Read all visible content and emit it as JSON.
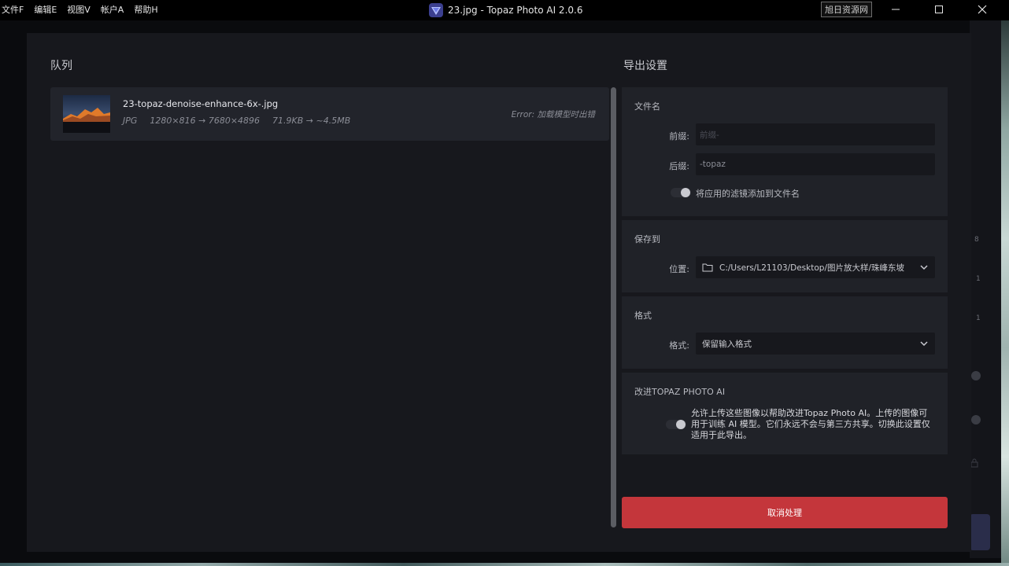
{
  "menu": [
    "文件F",
    "编辑E",
    "视图V",
    "帐户A",
    "帮助H"
  ],
  "window": {
    "title": "23.jpg - Topaz Photo AI 2.0.6"
  },
  "brand_badge": "旭日资源网",
  "background": {
    "numbers": [
      "8",
      "1",
      "1"
    ]
  },
  "queue": {
    "title": "队列",
    "items": [
      {
        "filename": "23-topaz-denoise-enhance-6x-.jpg",
        "format": "JPG",
        "resolution": "1280×816 → 7680×4896",
        "size": "71.9KB → ~4.5MB",
        "status": "Error: 加载模型时出错"
      }
    ]
  },
  "export": {
    "title": "导出设置",
    "filename": {
      "section_title": "文件名",
      "prefix_label": "前缀:",
      "prefix_placeholder": "前缀-",
      "suffix_label": "后缀:",
      "suffix_value": "-topaz",
      "filter_toggle_label": "将应用的滤镜添加到文件名",
      "filter_toggle_on": false
    },
    "save": {
      "section_title": "保存到",
      "location_label": "位置:",
      "location_value": "C:/Users/L21103/Desktop/图片放大样/珠峰东坡"
    },
    "format": {
      "section_title": "格式",
      "format_label": "格式:",
      "format_value": "保留输入格式"
    },
    "improve": {
      "section_title": "改进TOPAZ PHOTO AI",
      "toggle_on": false,
      "description": "允许上传这些图像以帮助改进Topaz Photo AI。上传的图像可用于训练 AI 模型。它们永远不会与第三方共享。切换此设置仅适用于此导出。"
    },
    "cancel_button": "取消处理"
  },
  "colors": {
    "accent_red": "#c4363b",
    "panel_bg": "#202228",
    "modal_bg": "#17181d"
  }
}
